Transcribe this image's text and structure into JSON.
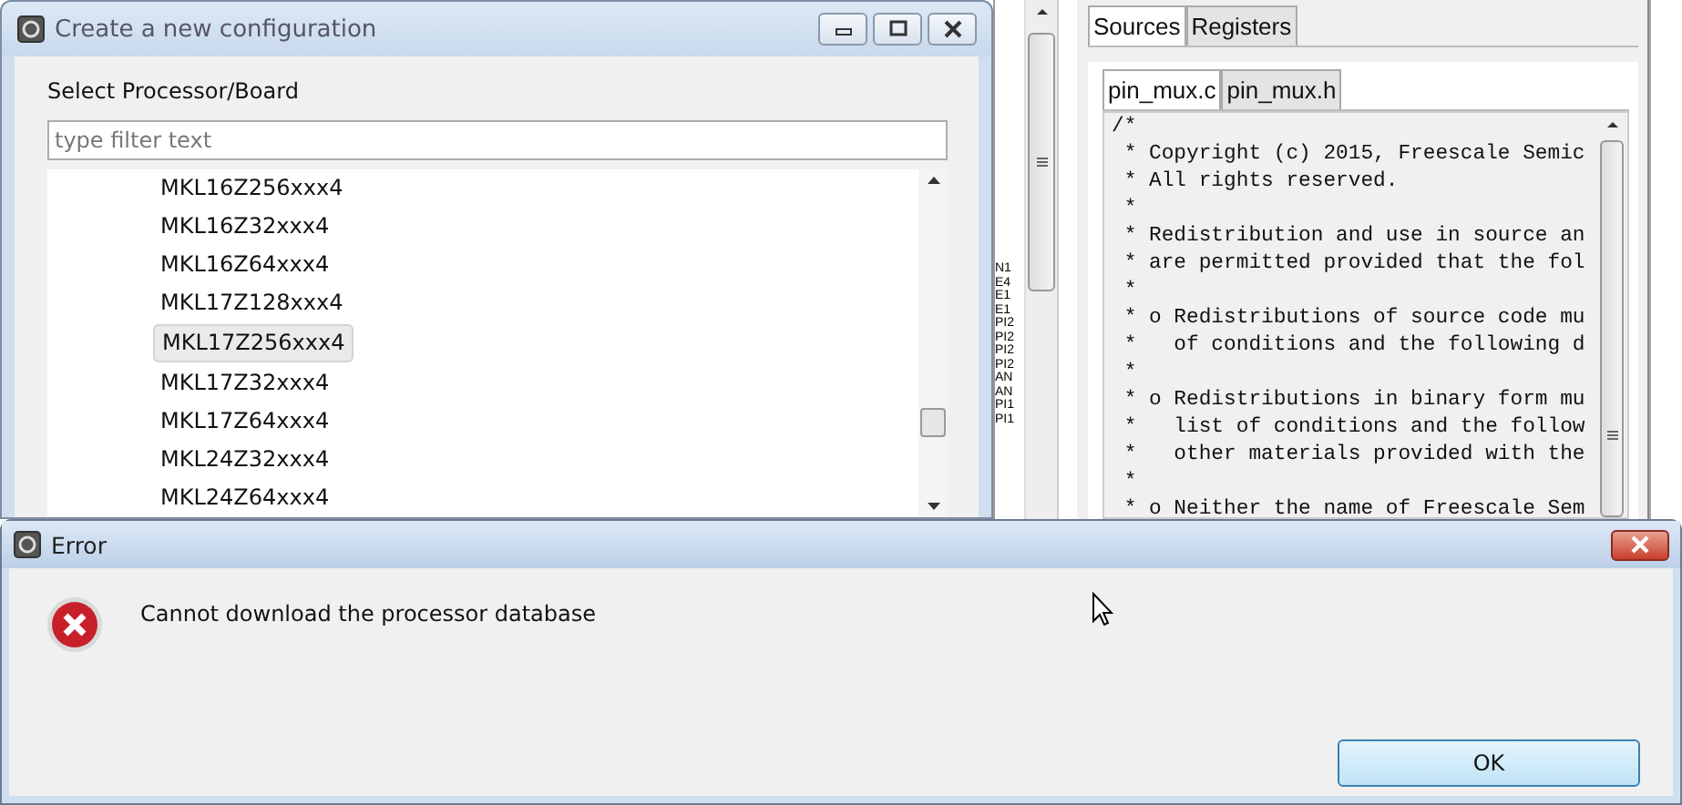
{
  "config_dialog": {
    "title": "Create a new configuration",
    "label": "Select Processor/Board",
    "filter": {
      "placeholder": "type filter text"
    },
    "items": [
      {
        "label": "MKL16Z256xxx4",
        "selected": false
      },
      {
        "label": "MKL16Z32xxx4",
        "selected": false
      },
      {
        "label": "MKL16Z64xxx4",
        "selected": false
      },
      {
        "label": "MKL17Z128xxx4",
        "selected": false
      },
      {
        "label": "MKL17Z256xxx4",
        "selected": true
      },
      {
        "label": "MKL17Z32xxx4",
        "selected": false
      },
      {
        "label": "MKL17Z64xxx4",
        "selected": false
      },
      {
        "label": "MKL24Z32xxx4",
        "selected": false
      },
      {
        "label": "MKL24Z64xxx4",
        "selected": false
      }
    ]
  },
  "side_fragments": [
    "N1",
    "E4",
    "E1",
    "E1",
    "PI2",
    "PI2",
    "PI2",
    "PI2",
    "AN",
    "AN",
    "PI1",
    "PI1"
  ],
  "editor": {
    "tabs": [
      {
        "label": "Sources",
        "selected": true
      },
      {
        "label": "Registers",
        "selected": false
      }
    ],
    "file_tabs": [
      {
        "label": "pin_mux.c",
        "selected": true
      },
      {
        "label": "pin_mux.h",
        "selected": false
      }
    ],
    "code_lines": [
      "/*",
      " * Copyright (c) 2015, Freescale Semic",
      " * All rights reserved.",
      " *",
      " * Redistribution and use in source an",
      " * are permitted provided that the fol",
      " *",
      " * o Redistributions of source code mu",
      " *   of conditions and the following d",
      " *",
      " * o Redistributions in binary form mu",
      " *   list of conditions and the follow",
      " *   other materials provided with the",
      " *",
      " * o Neither the name of Freescale Sem"
    ]
  },
  "error_dialog": {
    "title": "Error",
    "message": "Cannot download the processor database",
    "buttons": [
      "OK"
    ]
  }
}
